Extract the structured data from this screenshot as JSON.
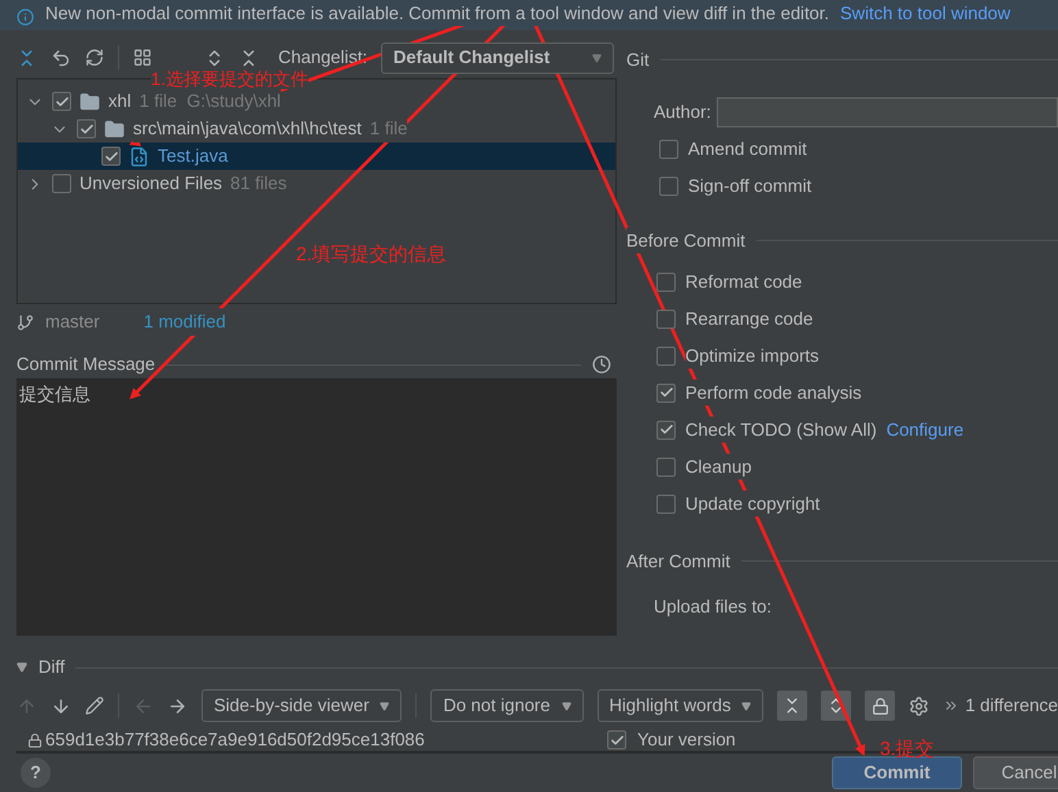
{
  "banner": {
    "text": "New non-modal commit interface is available. Commit from a tool window and view diff in the editor.",
    "link": "Switch to tool window"
  },
  "toolbar": {
    "changelist_label": "Changelist:",
    "changelist_value": "Default Changelist"
  },
  "tree": [
    {
      "kind": "module",
      "name": "xhl",
      "meta": "1 file  G:\\study\\xhl",
      "checked": true,
      "expanded": true,
      "selected": false,
      "children": [
        {
          "kind": "folder",
          "name": "src\\main\\java\\com\\xhl\\hc\\test",
          "meta": "1 file",
          "checked": true,
          "expanded": true,
          "selected": false,
          "children": [
            {
              "kind": "file",
              "name": "Test.java",
              "checked": true,
              "selected": true
            }
          ]
        }
      ]
    },
    {
      "kind": "group",
      "name": "Unversioned Files",
      "meta": "81 files",
      "checked": false,
      "expanded": false,
      "selected": false
    }
  ],
  "branch": {
    "name": "master",
    "status": "1 modified"
  },
  "commit_message": {
    "label": "Commit Message",
    "value": "提交信息"
  },
  "git": {
    "title": "Git",
    "author_label": "Author:",
    "options": [
      {
        "label": "Amend commit",
        "checked": false
      },
      {
        "label": "Sign-off commit",
        "checked": false
      }
    ]
  },
  "before_commit": {
    "title": "Before Commit",
    "options": [
      {
        "label": "Reformat code",
        "checked": false
      },
      {
        "label": "Rearrange code",
        "checked": false
      },
      {
        "label": "Optimize imports",
        "checked": false
      },
      {
        "label": "Perform code analysis",
        "checked": true
      },
      {
        "label": "Check TODO (Show All)",
        "checked": true,
        "link": "Configure"
      },
      {
        "label": "Cleanup",
        "checked": false
      },
      {
        "label": "Update copyright",
        "checked": false
      }
    ]
  },
  "after_commit": {
    "title": "After Commit",
    "upload_label": "Upload files to:"
  },
  "diff": {
    "title": "Diff",
    "expanded": true,
    "viewer": "Side-by-side viewer",
    "ignore": "Do not ignore",
    "highlight": "Highlight words",
    "differences": "1 difference",
    "hash": "659d1e3b77f38e6ce7a9e916d50f2d95ce13f086",
    "your_version": {
      "label": "Your version",
      "checked": true
    }
  },
  "buttons": {
    "help": "?",
    "commit": "Commit",
    "cancel": "Cancel"
  },
  "annotations": [
    {
      "text": "1.选择要提交的文件"
    },
    {
      "text": "2.填写提交的信息"
    },
    {
      "text": "3.提交"
    }
  ]
}
